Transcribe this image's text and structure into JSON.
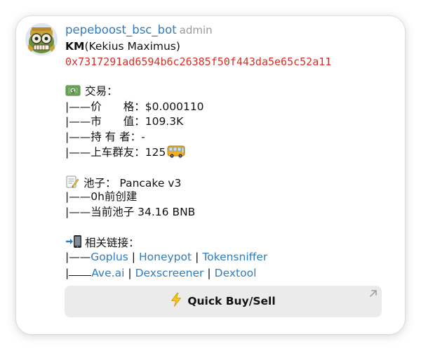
{
  "header": {
    "bot_name": "pepeboost_bsc_bot",
    "role": "admin"
  },
  "token": {
    "symbol": "KM",
    "name": "(Kekius Maximus)",
    "address": "0x7317291ad6594b6c26385f50f443da5e65c52a11"
  },
  "trade": {
    "heading": "交易：",
    "price_line": "|——价　　格：$0.000110",
    "mcap_line": "|——市　　值：109.3K",
    "holders_line": "|——持 有 者：-",
    "group_line": "|——上车群友：125"
  },
  "pool": {
    "heading": "池子：  Pancake v3",
    "created_line": "|——0h前创建",
    "current_line": "|——当前池子 34.16 BNB"
  },
  "links": {
    "heading": "相关链接：",
    "row1_prefix": "|——",
    "row2_prefix": "|",
    "items_row1": [
      "Goplus",
      "Honeypot",
      "Tokensniffer"
    ],
    "items_row2": [
      "Ave.ai",
      "Dexscreener",
      "Dextool"
    ],
    "separator": "|"
  },
  "button": {
    "label": "Quick Buy/Sell"
  },
  "icons": {
    "avatar": "pepe-avatar-icon",
    "money": "dollar-banknote-icon",
    "bus": "bus-icon",
    "memo": "memo-icon",
    "phone": "mobile-arrow-icon",
    "bolt": "lightning-icon",
    "corner": "arrow-up-right-icon"
  },
  "colors": {
    "link": "#2f7cc0",
    "address": "#d93025",
    "role": "#9a9a9a",
    "button_bg": "#ebebeb"
  }
}
